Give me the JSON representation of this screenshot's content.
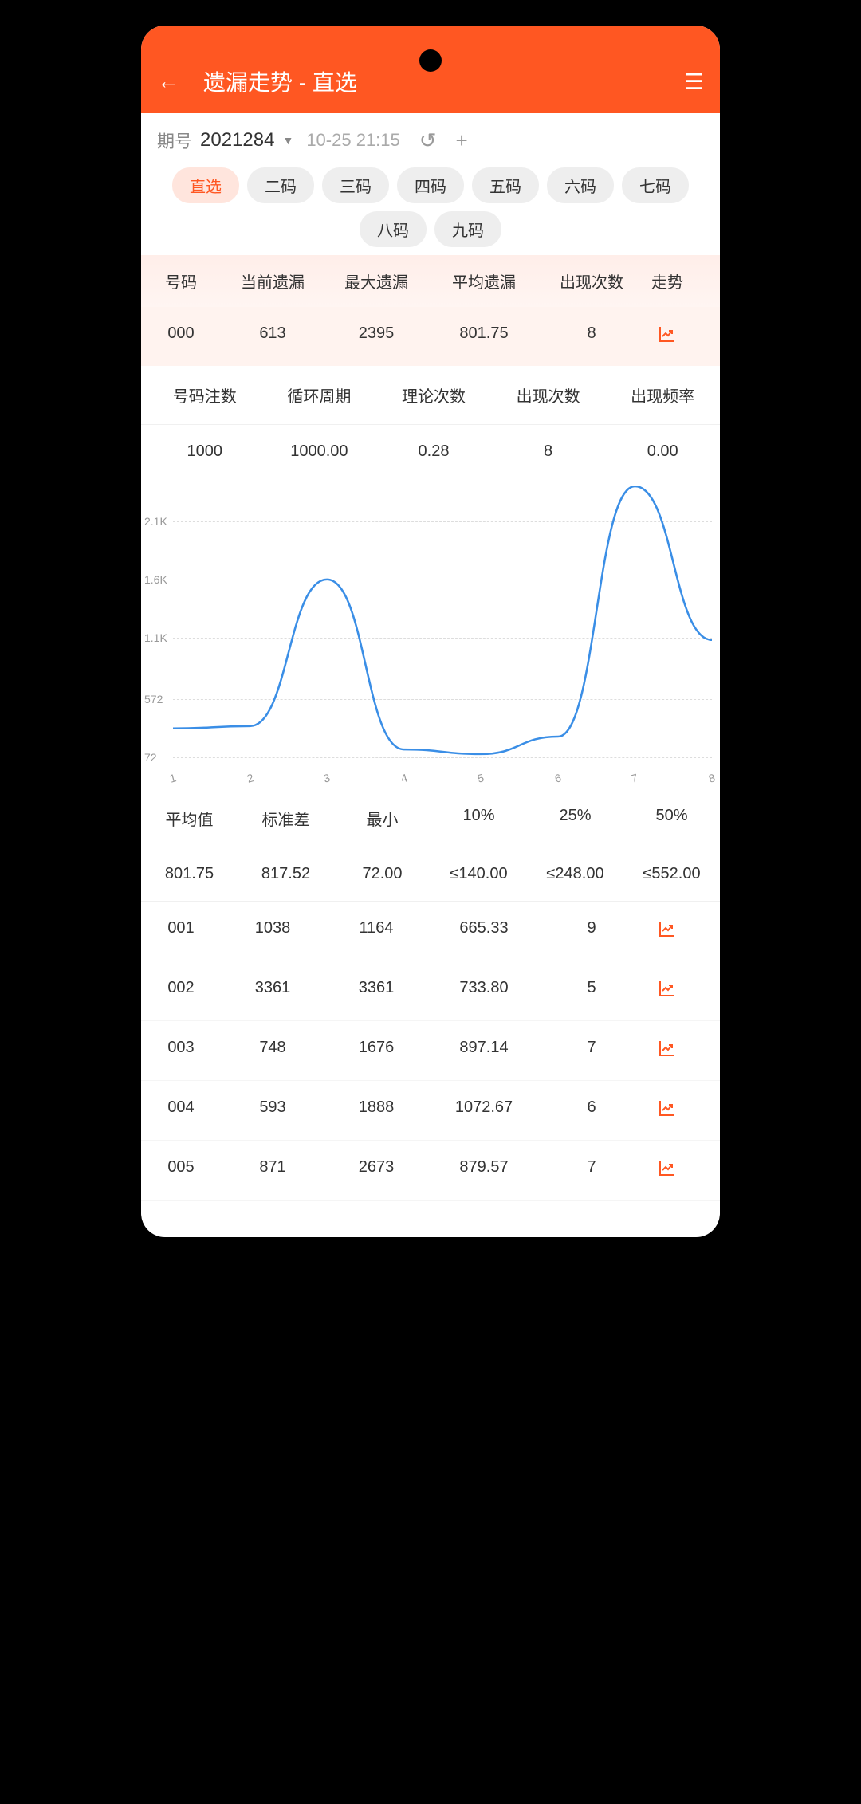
{
  "header": {
    "title": "遗漏走势 - 直选"
  },
  "controls": {
    "period_label": "期号",
    "period_value": "2021284",
    "timestamp": "10-25 21:15"
  },
  "tabs": [
    "直选",
    "二码",
    "三码",
    "四码",
    "五码",
    "六码",
    "七码",
    "八码",
    "九码"
  ],
  "active_tab": 0,
  "main_table": {
    "headers": [
      "号码",
      "当前遗漏",
      "最大遗漏",
      "平均遗漏",
      "出现次数",
      "走势"
    ],
    "selected_row": [
      "000",
      "613",
      "2395",
      "801.75",
      "8"
    ]
  },
  "stats": {
    "headers": [
      "号码注数",
      "循环周期",
      "理论次数",
      "出现次数",
      "出现频率"
    ],
    "values": [
      "1000",
      "1000.00",
      "0.28",
      "8",
      "0.00"
    ],
    "extra_header_partial": "平"
  },
  "chart_data": {
    "type": "line",
    "x": [
      1,
      2,
      3,
      4,
      5,
      6,
      7,
      8
    ],
    "values": [
      320,
      340,
      1600,
      140,
      100,
      250,
      2400,
      1080
    ],
    "yticks": [
      "72",
      "572",
      "1.1K",
      "1.6K",
      "2.1K"
    ],
    "ylim": [
      72,
      2400
    ]
  },
  "percentiles": {
    "headers": [
      "平均值",
      "标准差",
      "最小",
      "10%",
      "25%",
      "50%"
    ],
    "values": [
      "801.75",
      "817.52",
      "72.00",
      "≤140.00",
      "≤248.00",
      "≤552.00"
    ]
  },
  "rows": [
    {
      "code": "001",
      "cur": "1038",
      "max": "1164",
      "avg": "665.33",
      "cnt": "9"
    },
    {
      "code": "002",
      "cur": "3361",
      "max": "3361",
      "avg": "733.80",
      "cnt": "5"
    },
    {
      "code": "003",
      "cur": "748",
      "max": "1676",
      "avg": "897.14",
      "cnt": "7"
    },
    {
      "code": "004",
      "cur": "593",
      "max": "1888",
      "avg": "1072.67",
      "cnt": "6"
    },
    {
      "code": "005",
      "cur": "871",
      "max": "2673",
      "avg": "879.57",
      "cnt": "7"
    }
  ]
}
